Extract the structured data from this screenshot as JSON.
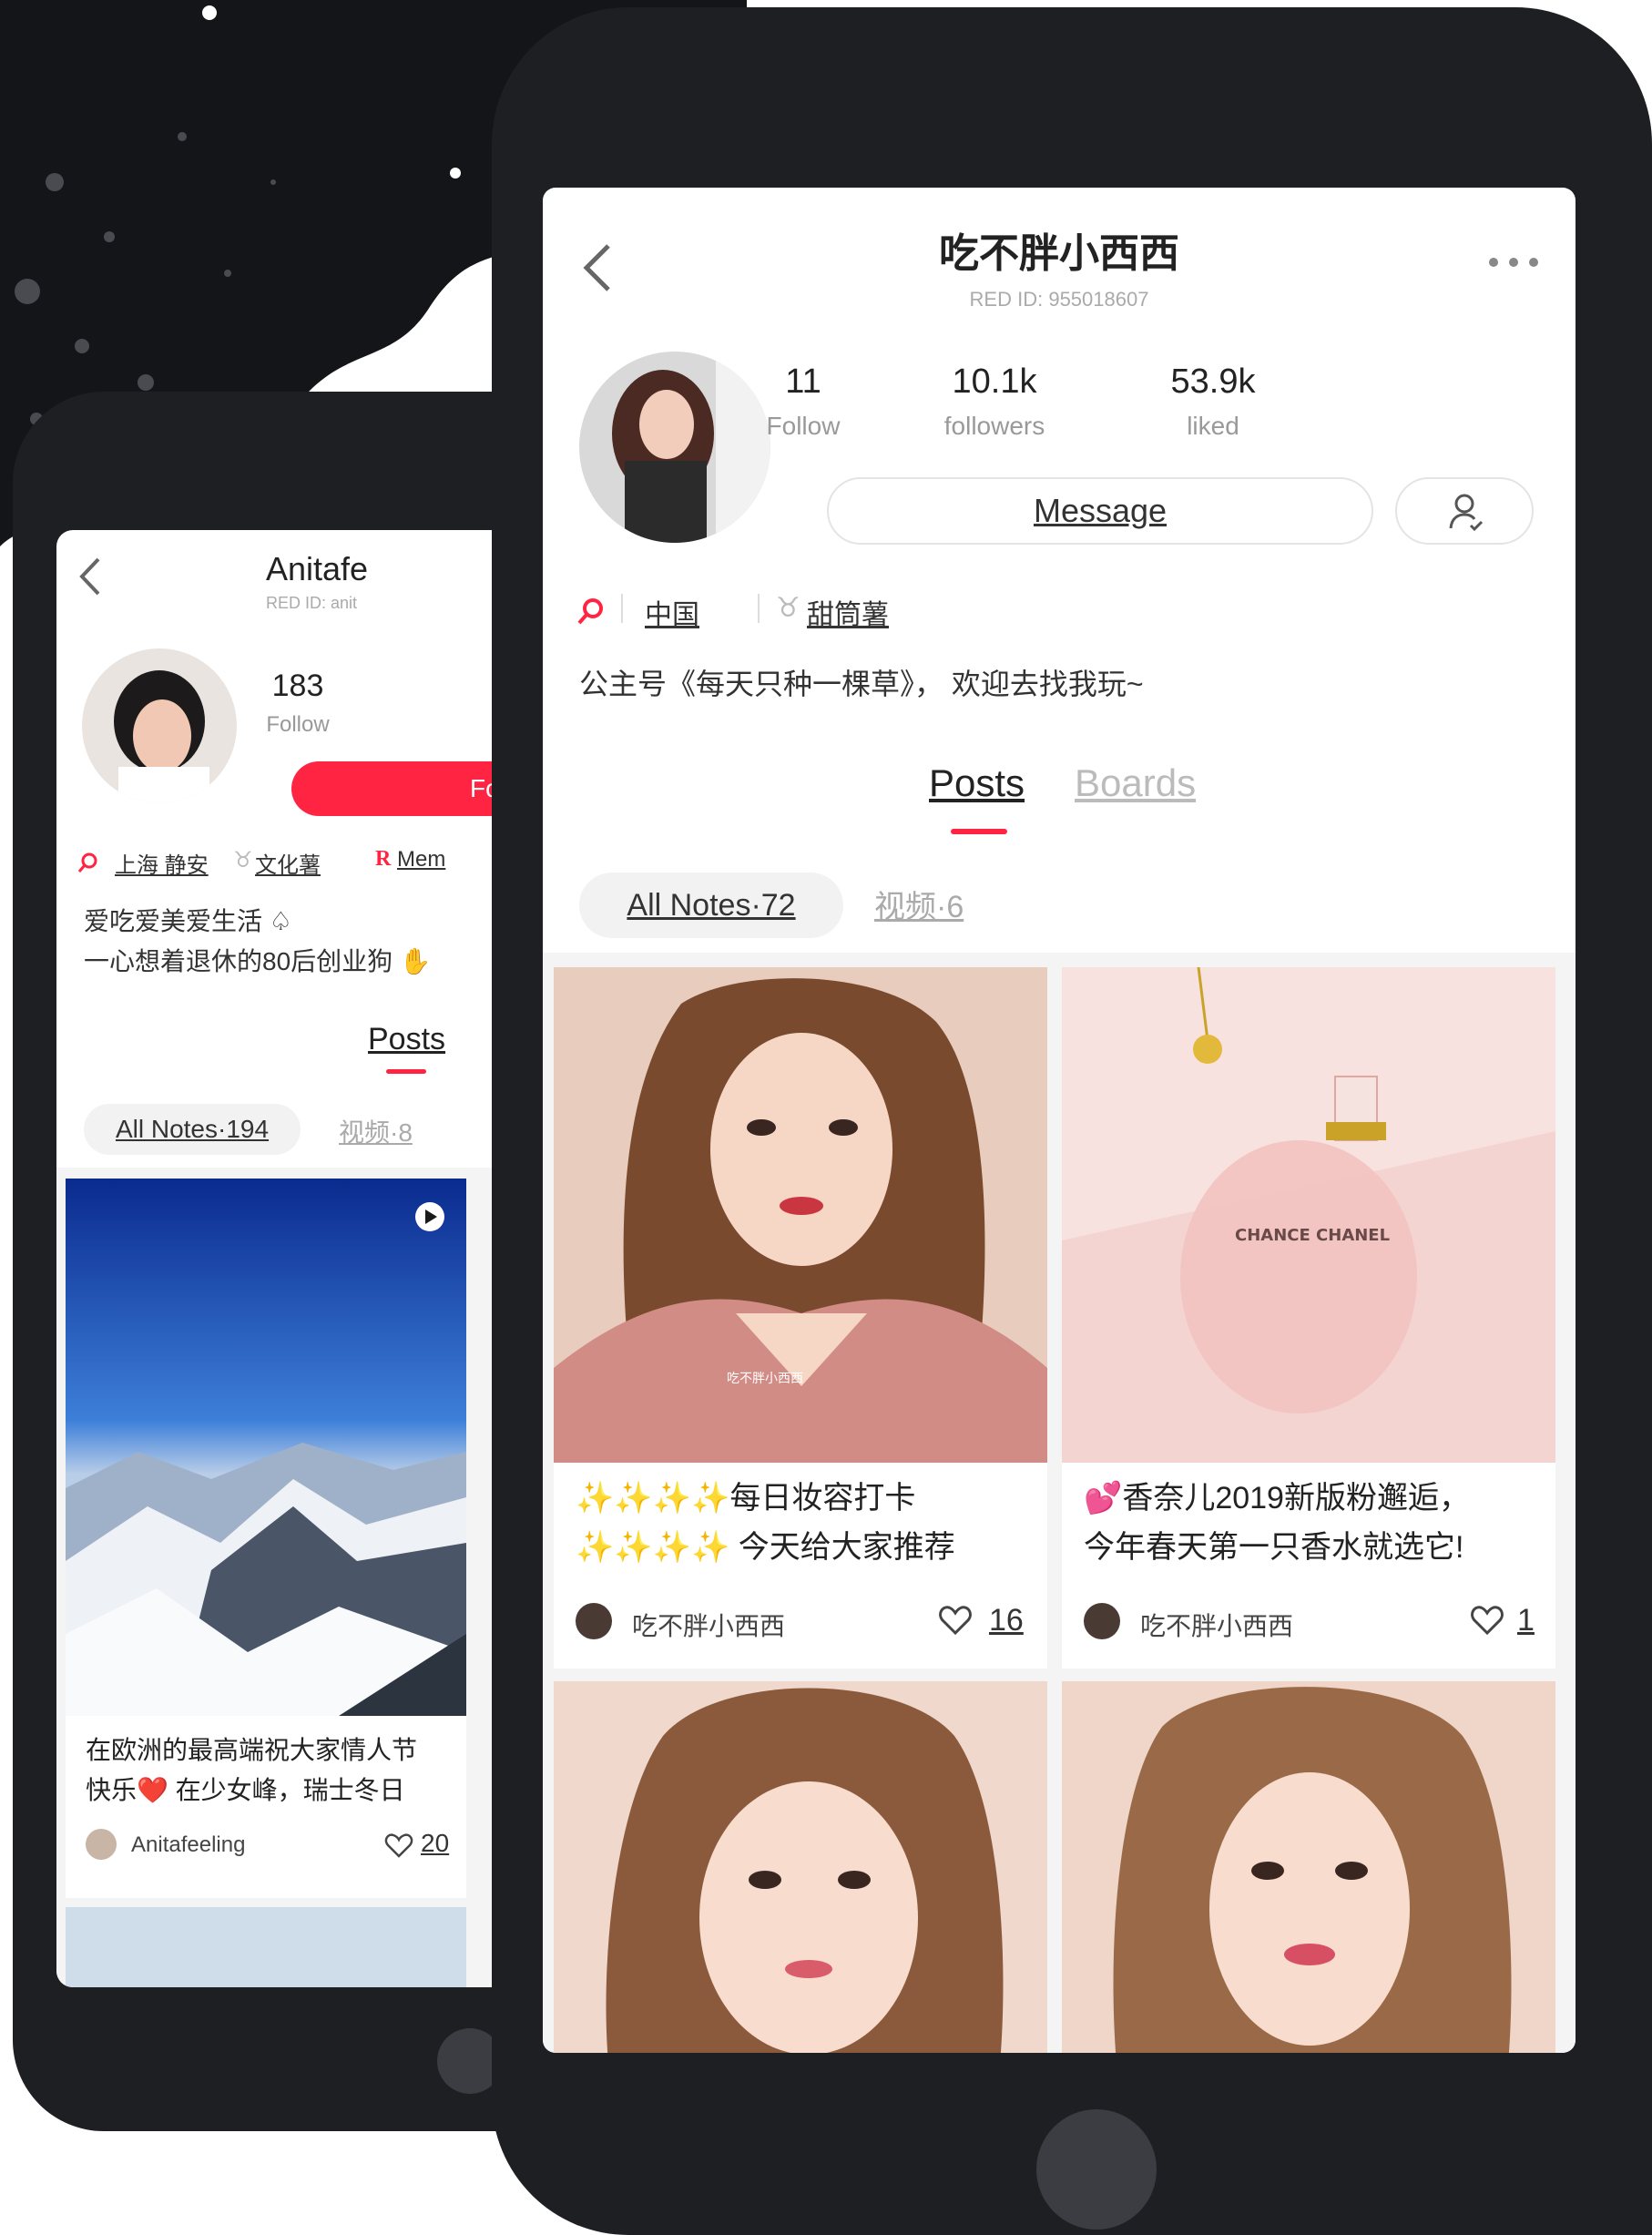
{
  "front": {
    "header": {
      "title": "吃不胖小西西",
      "red_id": "RED ID: 955018607"
    },
    "stats": [
      {
        "value": "11",
        "label": "Follow"
      },
      {
        "value": "10.1k",
        "label": "followers"
      },
      {
        "value": "53.9k",
        "label": "liked"
      }
    ],
    "message_button": "Message",
    "tags": {
      "location": "中国",
      "level": "甜筒薯"
    },
    "bio": "公主号《每天只种一棵草》， 欢迎去找我玩~",
    "tabs": {
      "posts": "Posts",
      "boards": "Boards"
    },
    "filters": {
      "all_notes": "All Notes·72",
      "video": "视频·6"
    },
    "cards": [
      {
        "title_line1": "✨✨✨✨每日妆容打卡",
        "title_line2": "✨✨✨✨ 今天给大家推荐",
        "author": "吃不胖小西西",
        "likes": "16",
        "image_text": "吃不胖小西西"
      },
      {
        "title_line1": "💕香奈儿2019新版粉邂逅，",
        "title_line2": "今年春天第一只香水就选它!",
        "author": "吃不胖小西西",
        "likes": "1",
        "image_text": "CHANCE CHANEL"
      }
    ]
  },
  "back": {
    "header": {
      "title": "Anitafe",
      "red_id": "RED ID: anit"
    },
    "follow": {
      "value": "183",
      "label": "Follow"
    },
    "follow_button": "Fo",
    "tags": {
      "location": "上海 静安",
      "level": "文化薯",
      "member": "Mem"
    },
    "bio_line1": "爱吃爱美爱生活 ♤",
    "bio_line2": "一心想着退休的80后创业狗 ✋",
    "tabs": {
      "posts": "Posts"
    },
    "filters": {
      "all_notes": "All Notes·194",
      "video": "视频·8"
    },
    "card": {
      "title_line1": "在欧洲的最高端祝大家情人节",
      "title_line2": "快乐❤️ 在少女峰，瑞士冬日",
      "author": "Anitafeeling",
      "likes": "20"
    }
  },
  "colors": {
    "accent": "#ff2442",
    "phone_body": "#1e1f23",
    "muted_text": "#999999"
  }
}
